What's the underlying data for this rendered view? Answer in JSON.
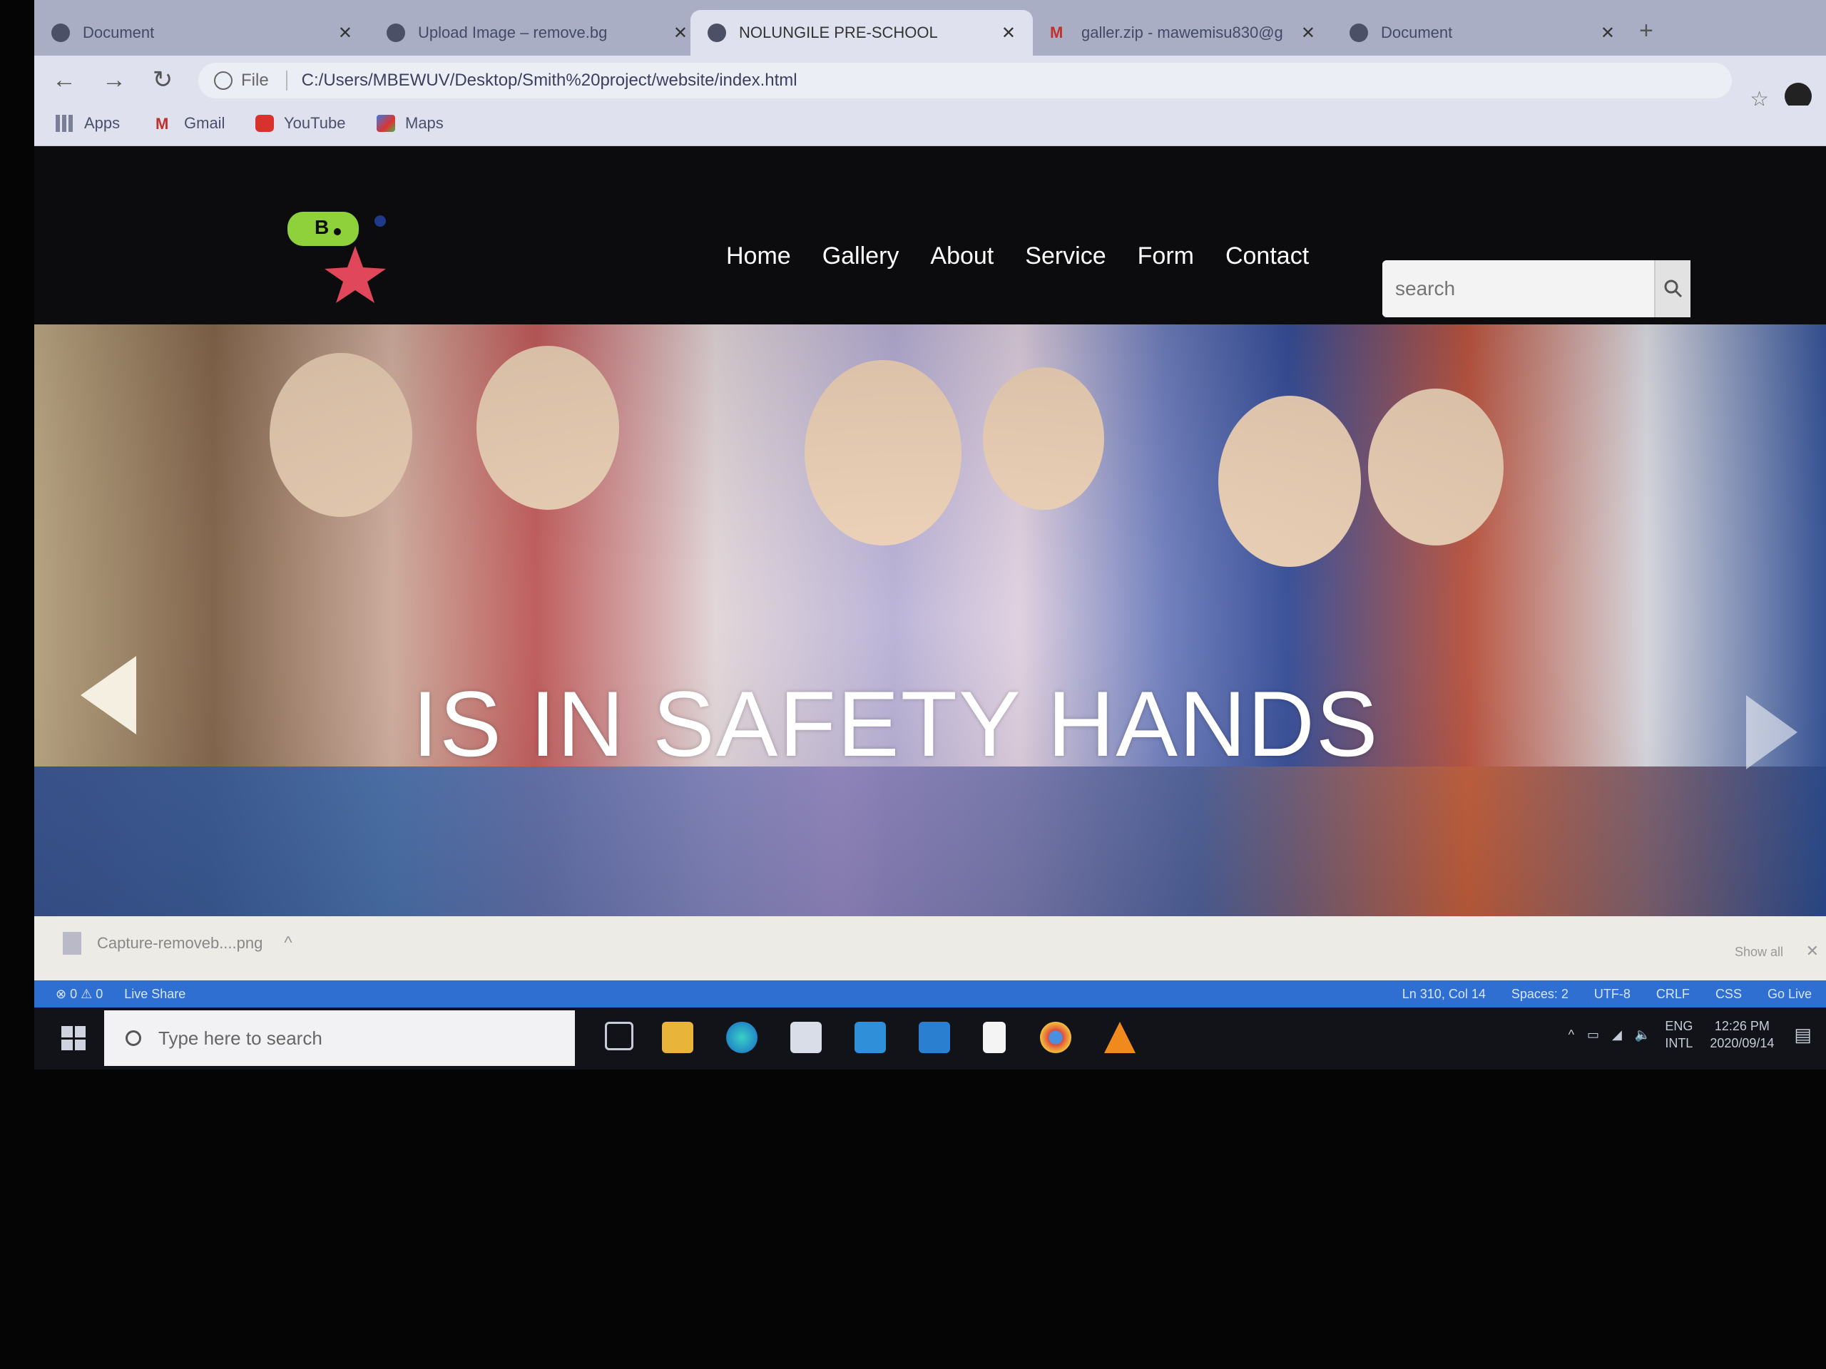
{
  "browser": {
    "tabs": [
      {
        "title": "Document",
        "active": false
      },
      {
        "title": "Upload Image – remove.bg",
        "active": false
      },
      {
        "title": "NOLUNGILE PRE-SCHOOL",
        "active": true
      },
      {
        "title": "galler.zip - mawemisu830@g",
        "active": false
      },
      {
        "title": "Document",
        "active": false
      }
    ],
    "address": {
      "chip": "File",
      "url": "C:/Users/MBEWUV/Desktop/Smith%20project/website/index.html"
    },
    "bookmarks": [
      "Apps",
      "Gmail",
      "YouTube",
      "Maps"
    ]
  },
  "site": {
    "logo_letter": "B",
    "nav": [
      "Home",
      "Gallery",
      "About",
      "Service",
      "Form",
      "Contact"
    ],
    "search": {
      "placeholder": "search"
    },
    "hero": {
      "text": "IS IN SAFETY HANDS"
    }
  },
  "downloads": {
    "file": "Capture-removeb....png",
    "show_all": "Show all"
  },
  "vscode_status": {
    "left": [
      "⊗ 0 ⚠ 0",
      "Live Share"
    ],
    "right": [
      "Ln 310, Col 14",
      "Spaces: 2",
      "UTF-8",
      "CRLF",
      "CSS",
      "Go Live"
    ]
  },
  "taskbar": {
    "search_placeholder": "Type here to search",
    "lang_top": "ENG",
    "lang_bottom": "INTL",
    "time": "12:26 PM",
    "date": "2020/09/14"
  },
  "colors": {
    "hero_text": "#ffffff",
    "header_bg": "#0c0c0e",
    "vscode_blue": "#2f6fd1",
    "logo_green": "#8fd13a",
    "logo_star": "#e0475a"
  }
}
